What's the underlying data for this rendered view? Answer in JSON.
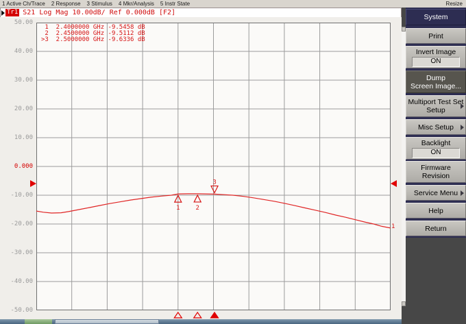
{
  "menu_bar": {
    "items": [
      "1 Active Ch/Trace",
      "2 Response",
      "3 Stimulus",
      "4 Mkr/Analysis",
      "5 Instr State"
    ],
    "resize_label": "Resize"
  },
  "trace_status": {
    "trace_badge": "Tr1",
    "text": "S21 Log Mag 10.00dB/ Ref 0.000dB [F2]"
  },
  "plot": {
    "y_axis_labels": [
      "50.00",
      "40.00",
      "30.00",
      "20.00",
      "10.00",
      "0.000",
      "-10.00",
      "-20.00",
      "-30.00",
      "-40.00",
      "-50.00"
    ],
    "reference_label": "0.000",
    "trace_end_label": "1",
    "accent_red": "#d61414",
    "grid_color": "#9b9b9b"
  },
  "chart_data": {
    "type": "line",
    "title": "Tr1 S21 Log Mag 10.00dB/ Ref 0.000dB",
    "ylabel": "dB",
    "ylim": [
      -50,
      50
    ],
    "y_ticks": [
      50,
      40,
      30,
      20,
      10,
      0,
      -10,
      -20,
      -30,
      -40,
      -50
    ],
    "x_divisions": 10,
    "y_divisions": 10,
    "scale_db_per_div": 10,
    "reference_level_db": 0,
    "grid": true,
    "series": [
      {
        "name": "Tr1 S21",
        "color": "#e02424",
        "points": [
          [
            0.0,
            -15.5
          ],
          [
            0.02,
            -15.9
          ],
          [
            0.043,
            -16.2
          ],
          [
            0.07,
            -16.1
          ],
          [
            0.091,
            -15.7
          ],
          [
            0.12,
            -15.0
          ],
          [
            0.149,
            -14.3
          ],
          [
            0.178,
            -13.6
          ],
          [
            0.207,
            -12.9
          ],
          [
            0.236,
            -12.3
          ],
          [
            0.265,
            -11.7
          ],
          [
            0.294,
            -11.2
          ],
          [
            0.323,
            -10.7
          ],
          [
            0.352,
            -10.3
          ],
          [
            0.381,
            -10.0
          ],
          [
            0.4,
            -9.55
          ],
          [
            0.428,
            -9.5
          ],
          [
            0.455,
            -9.51
          ],
          [
            0.48,
            -9.55
          ],
          [
            0.503,
            -9.63
          ],
          [
            0.53,
            -9.8
          ],
          [
            0.555,
            -10.0
          ],
          [
            0.585,
            -10.4
          ],
          [
            0.613,
            -10.9
          ],
          [
            0.642,
            -11.5
          ],
          [
            0.671,
            -12.1
          ],
          [
            0.7,
            -12.8
          ],
          [
            0.729,
            -13.6
          ],
          [
            0.758,
            -14.4
          ],
          [
            0.787,
            -15.2
          ],
          [
            0.816,
            -16.0
          ],
          [
            0.845,
            -16.9
          ],
          [
            0.874,
            -17.7
          ],
          [
            0.903,
            -18.6
          ],
          [
            0.93,
            -19.4
          ],
          [
            0.952,
            -20.0
          ],
          [
            0.975,
            -20.8
          ],
          [
            1.0,
            -21.4
          ]
        ]
      }
    ],
    "markers": [
      {
        "id": "1",
        "freq": "2.4000000 GHz",
        "value": "-9.5458 dB",
        "db": -9.5458,
        "x_frac": 0.4,
        "active": false
      },
      {
        "id": "2",
        "freq": "2.4500000 GHz",
        "value": "-9.5112 dB",
        "db": -9.5112,
        "x_frac": 0.455,
        "active": false
      },
      {
        "id": "3",
        "freq": "2.5000000 GHz",
        "value": "-9.6336 dB",
        "db": -9.6336,
        "x_frac": 0.503,
        "active": true
      }
    ]
  },
  "sidebar": {
    "buttons": [
      {
        "lines": [
          "System"
        ],
        "kind": "header"
      },
      {
        "lines": [
          "Print"
        ],
        "kind": "normal"
      },
      {
        "lines": [
          "Invert Image"
        ],
        "sub": "ON",
        "kind": "toggle"
      },
      {
        "lines": [
          "Dump",
          "Screen Image..."
        ],
        "kind": "active"
      },
      {
        "lines": [
          "Multiport Test Set",
          "Setup"
        ],
        "kind": "normal",
        "arrow": true
      },
      {
        "lines": [
          "Misc Setup"
        ],
        "kind": "normal",
        "arrow": true
      },
      {
        "lines": [
          "Backlight"
        ],
        "sub": "ON",
        "kind": "toggle"
      },
      {
        "lines": [
          "Firmware",
          "Revision"
        ],
        "kind": "normal"
      },
      {
        "lines": [
          "Service Menu"
        ],
        "kind": "normal",
        "arrow": true
      },
      {
        "lines": [
          "Help"
        ],
        "kind": "normal"
      },
      {
        "lines": [
          "Return"
        ],
        "kind": "normal"
      }
    ]
  }
}
